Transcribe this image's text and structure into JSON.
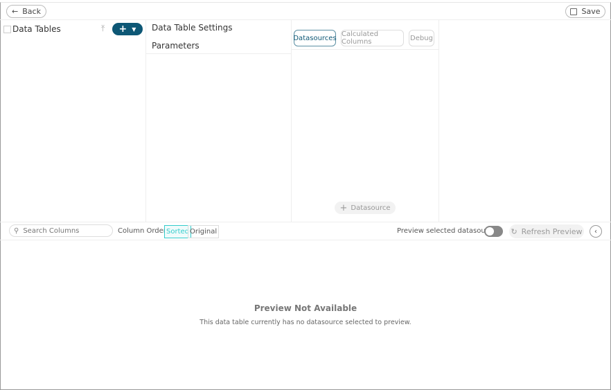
{
  "header": {
    "back_label": "Back",
    "save_label": "Save"
  },
  "data_tables": {
    "title": "Data Tables"
  },
  "settings": {
    "items": [
      "Data Table Settings",
      "Parameters"
    ]
  },
  "tabs": [
    {
      "label": "Datasources",
      "active": true
    },
    {
      "label": "Calculated Columns"
    },
    {
      "label": "Debug"
    }
  ],
  "add_datasource_label": "Datasource",
  "toolbar": {
    "search_placeholder": "Search Columns",
    "column_order_label": "Column Order",
    "sorted_label": "Sorted",
    "original_label": "Original",
    "preview_toggle_label": "Preview selected datasource",
    "preview_toggle_on": false,
    "refresh_label": "Refresh Preview"
  },
  "preview": {
    "title": "Preview Not Available",
    "message": "This data table currently has no datasource selected to preview."
  },
  "colors": {
    "accent": "#0d5775",
    "sorted": "#3cc"
  }
}
